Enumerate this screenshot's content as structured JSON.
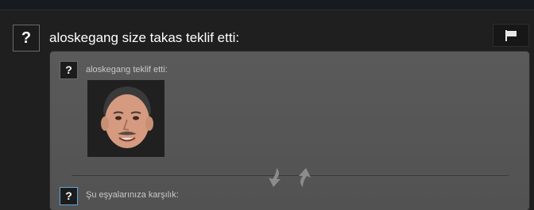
{
  "header": {
    "icon_label": "?",
    "title": "aloskegang size takas teklif etti:"
  },
  "offer": {
    "icon_label": "?",
    "label": "aloskegang teklif etti:",
    "item_image": "person-portrait"
  },
  "in_return": {
    "icon_label": "?",
    "label": "Şu eşyalarınıza karşılık:"
  },
  "icons": [
    "flag-icon",
    "arrow-down-icon",
    "arrow-up-icon"
  ]
}
